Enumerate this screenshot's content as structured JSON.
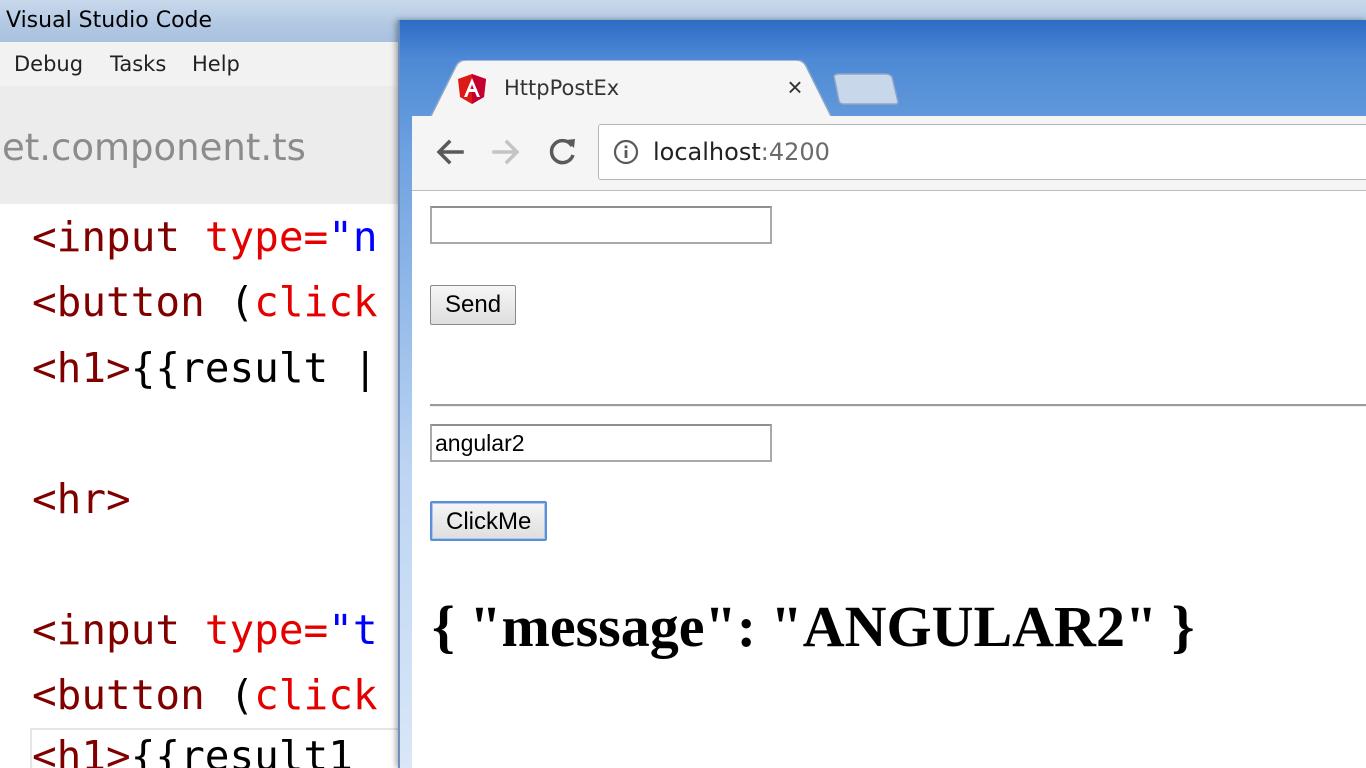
{
  "vscode": {
    "title": "Visual Studio Code",
    "menu": [
      "Debug",
      "Tasks",
      "Help"
    ],
    "active_tab": "et.component.ts",
    "code_lines": [
      {
        "tag": "<input",
        "attr": " type=",
        "str": "\"n"
      },
      {
        "tag": "<button",
        "plain": " (",
        "attr": "click"
      },
      {
        "tag": "<h1>",
        "plain": "{{result |"
      },
      {
        "tag": "<hr>"
      },
      {
        "tag": "<input",
        "attr": " type=",
        "str": "\"t"
      },
      {
        "tag": "<button",
        "plain": " (",
        "attr": "click"
      },
      {
        "tag": "<h1>",
        "plain": "{{result1"
      }
    ]
  },
  "chrome": {
    "tab_title": "HttpPostEx",
    "tab_close_glyph": "×",
    "url_host": "localhost",
    "url_port": ":4200"
  },
  "page": {
    "input1_value": "",
    "send_label": "Send",
    "input2_value": "angular2",
    "clickme_label": "ClickMe",
    "result_text": "{ \"message\": \"ANGULAR2\" }"
  },
  "colors": {
    "angular_red": "#dd1b16",
    "button_focus": "#5d8fd6"
  },
  "icons": {
    "favicon": "angular-icon",
    "back": "arrow-left-icon",
    "forward": "arrow-right-icon",
    "reload": "reload-icon",
    "info": "info-icon"
  }
}
